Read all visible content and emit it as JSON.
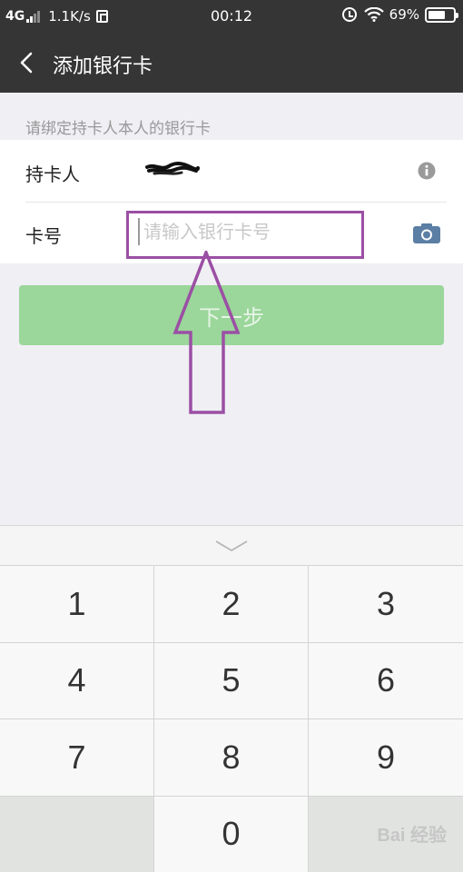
{
  "status_bar": {
    "network": "4G",
    "speed": "1.1K/s",
    "time": "00:12",
    "battery_percent": "69%",
    "battery_level": 0.69
  },
  "nav": {
    "back_icon": "chevron-left-icon",
    "title": "添加银行卡"
  },
  "hint": "请绑定持卡人本人的银行卡",
  "form": {
    "holder_label": "持卡人",
    "card_label": "卡号",
    "card_placeholder": "请输入银行卡号",
    "card_value": ""
  },
  "next_button": "下一步",
  "keyboard": {
    "keys": [
      "1",
      "2",
      "3",
      "4",
      "5",
      "6",
      "7",
      "8",
      "9",
      "",
      "0",
      ""
    ]
  },
  "watermark": "Bai 经验",
  "colors": {
    "header_bg": "#353535",
    "button_green": "#9bd69b",
    "annotation_purple": "#9b4fa4"
  }
}
